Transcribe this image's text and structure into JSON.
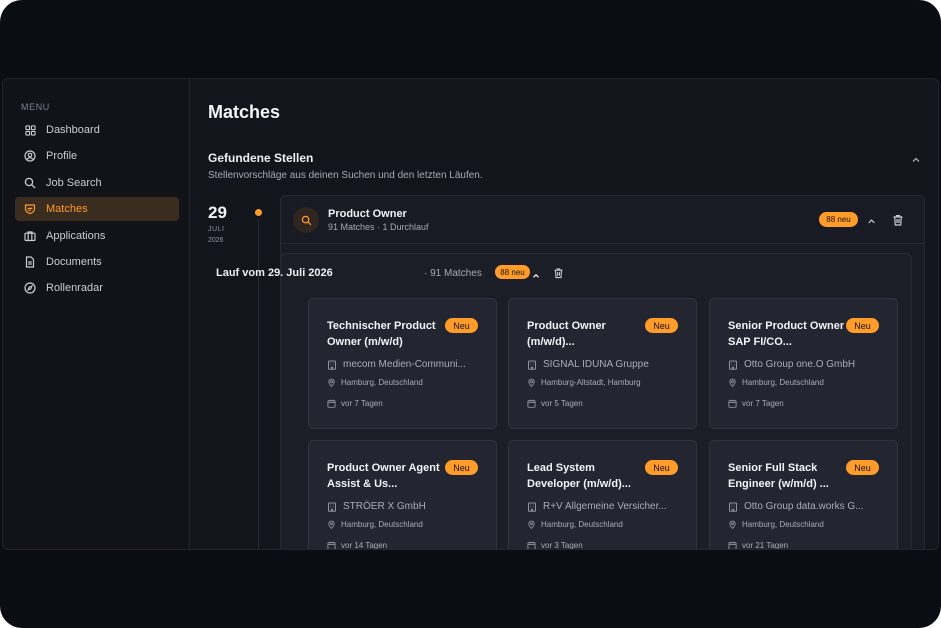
{
  "sidebar": {
    "menu_label": "MENU",
    "items": [
      {
        "label": "Dashboard",
        "icon": "grid-icon"
      },
      {
        "label": "Profile",
        "icon": "user-circle-icon"
      },
      {
        "label": "Job Search",
        "icon": "search-icon"
      },
      {
        "label": "Matches",
        "icon": "matches-icon",
        "active": true
      },
      {
        "label": "Applications",
        "icon": "briefcase-icon"
      },
      {
        "label": "Documents",
        "icon": "document-icon"
      },
      {
        "label": "Rollenradar",
        "icon": "compass-icon"
      }
    ]
  },
  "main": {
    "title": "Matches",
    "section_title": "Gefundene Stellen",
    "section_subtitle": "Stellenvorschläge aus deinen Suchen und den letzten Läufen.",
    "date": {
      "day": "29",
      "month": "JULI",
      "year": "2026"
    },
    "search": {
      "title": "Product Owner",
      "meta": "91 Matches · 1 Durchlauf",
      "badge": "88 neu"
    },
    "run": {
      "title": "Lauf vom 29. Juli 2026",
      "count": "· 91 Matches",
      "badge": "88 neu"
    },
    "jobs": [
      {
        "title": "Technischer Product Owner (m/w/d)",
        "badge": "Neu",
        "company": "mecom Medien-Communi...",
        "location": "Hamburg, Deutschland",
        "age": "vor 7 Tagen"
      },
      {
        "title": "Product Owner (m/w/d)...",
        "badge": "Neu",
        "company": "SIGNAL IDUNA Gruppe",
        "location": "Hamburg-Altstadt, Hamburg",
        "age": "vor 5 Tagen"
      },
      {
        "title": "Senior Product Owner SAP FI/CO...",
        "badge": "Neu",
        "company": "Otto Group one.O GmbH",
        "location": "Hamburg, Deutschland",
        "age": "vor 7 Tagen"
      },
      {
        "title": "Product Owner Agent Assist & Us...",
        "badge": "Neu",
        "company": "STRÖER X GmbH",
        "location": "Hamburg, Deutschland",
        "age": "vor 14 Tagen"
      },
      {
        "title": "Lead System Developer (m/w/d)...",
        "badge": "Neu",
        "company": "R+V Allgemeine Versicher...",
        "location": "Hamburg, Deutschland",
        "age": "vor 3 Tagen"
      },
      {
        "title": "Senior Full Stack Engineer (w/m/d) ...",
        "badge": "Neu",
        "company": "Otto Group data.works G...",
        "location": "Hamburg, Deutschland",
        "age": "vor 21 Tagen"
      }
    ]
  },
  "colors": {
    "accent": "#ff9c2a",
    "background": "#0b0d15",
    "panel": "#13151d",
    "card": "#232631"
  }
}
